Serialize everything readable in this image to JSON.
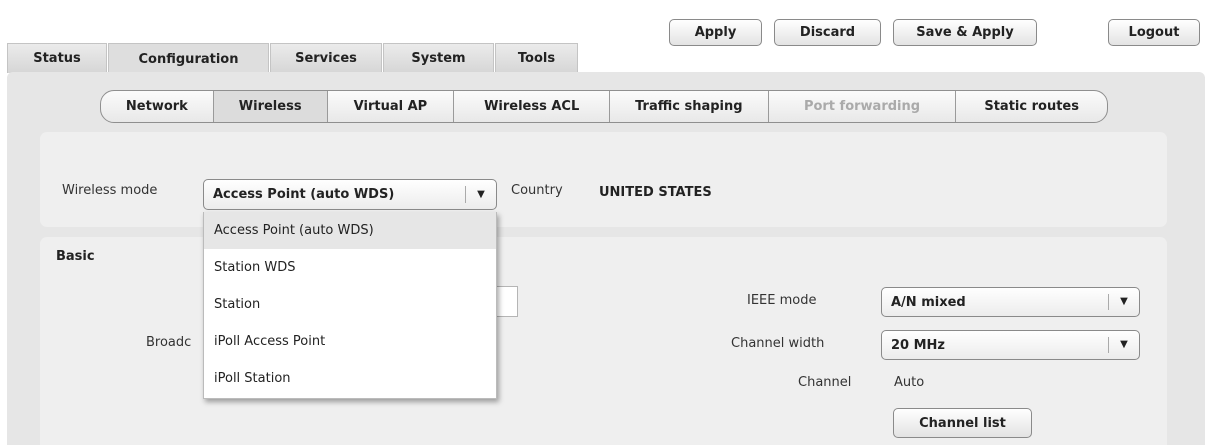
{
  "top_buttons": {
    "apply": "Apply",
    "discard": "Discard",
    "save_apply": "Save & Apply",
    "logout": "Logout"
  },
  "tabs": [
    "Status",
    "Configuration",
    "Services",
    "System",
    "Tools"
  ],
  "subnav": [
    "Network",
    "Wireless",
    "Virtual AP",
    "Wireless ACL",
    "Traffic shaping",
    "Port forwarding",
    "Static routes"
  ],
  "mode_row": {
    "wireless_mode_label": "Wireless mode",
    "wireless_mode_value": "Access Point (auto WDS)",
    "country_label": "Country",
    "country_value": "UNITED STATES"
  },
  "dropdown_options": [
    "Access Point (auto WDS)",
    "Station WDS",
    "Station",
    "iPoll Access Point",
    "iPoll Station"
  ],
  "basic": {
    "title": "Basic",
    "broadcast_label_fragment": "Broadc",
    "ieee_mode_label": "IEEE mode",
    "ieee_mode_value": "A/N mixed",
    "channel_width_label": "Channel width",
    "channel_width_value": "20 MHz",
    "channel_label": "Channel",
    "channel_value": "Auto",
    "channel_list_button": "Channel list"
  }
}
